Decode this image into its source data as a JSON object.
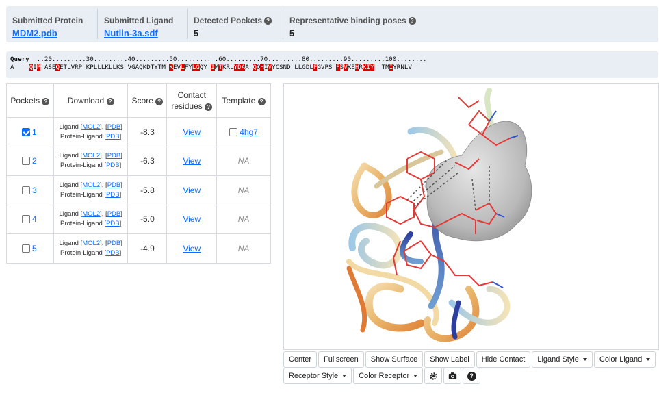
{
  "summary": {
    "protein_label": "Submitted Protein",
    "protein_value": "MDM2.pdb",
    "ligand_label": "Submitted Ligand",
    "ligand_value": "Nutlin-3a.sdf",
    "pockets_label": "Detected Pockets",
    "pockets_value": "5",
    "poses_label": "Representative binding poses",
    "poses_value": "5"
  },
  "sequence": {
    "query_label": "Query",
    "ruler": "..20.........30.........40.........50......... .60.........70.........80.........90.........100........",
    "chain": "A",
    "segments": [
      {
        "t": "    ",
        "h": false
      },
      {
        "t": "Q",
        "h": true
      },
      {
        "t": "I",
        "h": false
      },
      {
        "t": "P",
        "h": true
      },
      {
        "t": " ASE",
        "h": false
      },
      {
        "t": "Q",
        "h": true
      },
      {
        "t": "ETLVRP KPLLLKLLKS VGAQKDTYTM ",
        "h": false
      },
      {
        "t": "K",
        "h": true
      },
      {
        "t": "EV",
        "h": false
      },
      {
        "t": "L",
        "h": true
      },
      {
        "t": "FY",
        "h": false
      },
      {
        "t": "LG",
        "h": true
      },
      {
        "t": "QY ",
        "h": false
      },
      {
        "t": "I",
        "h": true
      },
      {
        "t": "M",
        "h": false
      },
      {
        "t": "T",
        "h": true
      },
      {
        "t": "KRL",
        "h": false
      },
      {
        "t": "YDA",
        "h": true
      },
      {
        "t": "A ",
        "h": false
      },
      {
        "t": "Q",
        "h": true
      },
      {
        "t": "Q",
        "h": false
      },
      {
        "t": "H",
        "h": true
      },
      {
        "t": "I",
        "h": false
      },
      {
        "t": "V",
        "h": true
      },
      {
        "t": "YCSND LLGDL",
        "h": false
      },
      {
        "t": "F",
        "h": true
      },
      {
        "t": "GVPS ",
        "h": false
      },
      {
        "t": "F",
        "h": true
      },
      {
        "t": "S",
        "h": false
      },
      {
        "t": "V",
        "h": true
      },
      {
        "t": "KE",
        "h": false
      },
      {
        "t": "H",
        "h": true
      },
      {
        "t": "R",
        "h": false
      },
      {
        "t": "KI",
        "h": true
      },
      {
        "t": "Y",
        "h": true
      },
      {
        "t": "  TM",
        "h": false
      },
      {
        "t": "I",
        "h": true
      },
      {
        "t": "YRNLV",
        "h": false
      }
    ]
  },
  "table": {
    "headers": {
      "pockets": "Pockets",
      "download": "Download",
      "score": "Score",
      "contact_1": "Contact",
      "contact_2": "residues",
      "template": "Template"
    },
    "rows": [
      {
        "pocket": "1",
        "checked": true,
        "ligand": "Ligand",
        "mol2": "MOL2",
        "pdb": "PDB",
        "pl": "Protein-Ligand",
        "pl_pdb": "PDB",
        "score": "-8.3",
        "contact": "View",
        "template": "4hg7",
        "template_link": true
      },
      {
        "pocket": "2",
        "checked": false,
        "ligand": "Ligand",
        "mol2": "MOL2",
        "pdb": "PDB",
        "pl": "Protein-Ligand",
        "pl_pdb": "PDB",
        "score": "-6.3",
        "contact": "View",
        "template": "NA",
        "template_link": false
      },
      {
        "pocket": "3",
        "checked": false,
        "ligand": "Ligand",
        "mol2": "MOL2",
        "pdb": "PDB",
        "pl": "Protein-Ligand",
        "pl_pdb": "PDB",
        "score": "-5.8",
        "contact": "View",
        "template": "NA",
        "template_link": false
      },
      {
        "pocket": "4",
        "checked": false,
        "ligand": "Ligand",
        "mol2": "MOL2",
        "pdb": "PDB",
        "pl": "Protein-Ligand",
        "pl_pdb": "PDB",
        "score": "-5.0",
        "contact": "View",
        "template": "NA",
        "template_link": false
      },
      {
        "pocket": "5",
        "checked": false,
        "ligand": "Ligand",
        "mol2": "MOL2",
        "pdb": "PDB",
        "pl": "Protein-Ligand",
        "pl_pdb": "PDB",
        "score": "-4.9",
        "contact": "View",
        "template": "NA",
        "template_link": false
      }
    ]
  },
  "toolbar": {
    "center": "Center",
    "fullscreen": "Fullscreen",
    "show_surface": "Show Surface",
    "show_label": "Show Label",
    "hide_contact": "Hide Contact",
    "ligand_style": "Ligand Style",
    "color_ligand": "Color Ligand",
    "receptor_style": "Receptor Style",
    "color_receptor": "Color Receptor",
    "icons": [
      "gear-icon",
      "camera-icon",
      "help-icon"
    ]
  },
  "colors": {
    "accent": "#0d6efd",
    "panel_bg": "#e9eef5",
    "highlight": "#d90000",
    "ligand": "#e53935",
    "surface": "#b8b8b8"
  }
}
